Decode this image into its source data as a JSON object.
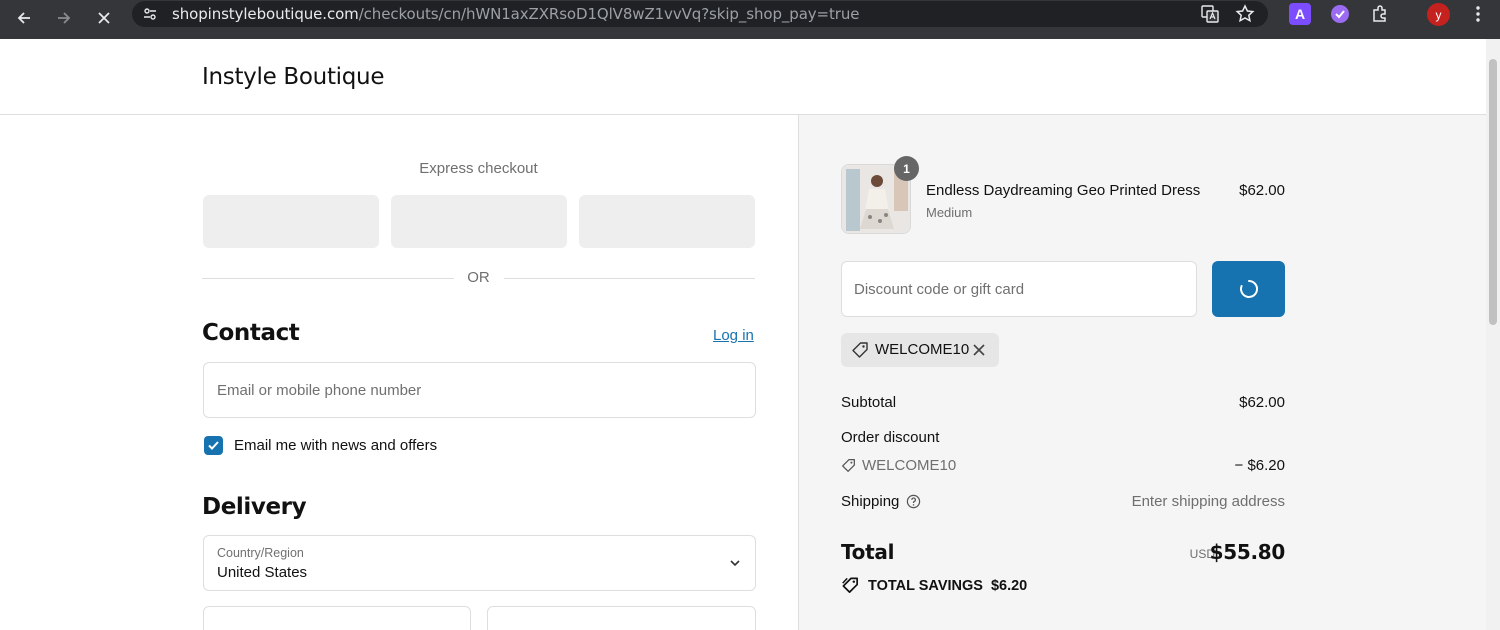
{
  "browser": {
    "url_host": "shopinstyleboutique.com",
    "url_path": "/checkouts/cn/hWN1axZXRsoD1QlV8wZ1vvVq?skip_shop_pay=true",
    "profile_initial": "Y",
    "extension_initial": "A",
    "icons": [
      "back-icon",
      "forward-icon",
      "stop-loading-icon",
      "site-settings-icon",
      "translate-icon",
      "star-icon",
      "extensions-icon",
      "menu-icon"
    ]
  },
  "header": {
    "shop_name": "Instyle Boutique"
  },
  "checkout": {
    "express_label": "Express checkout",
    "or_label": "OR",
    "contact": {
      "title": "Contact",
      "login_label": "Log in",
      "email_placeholder": "Email or mobile phone number",
      "newsletter_label": "Email me with news and offers",
      "newsletter_checked": true
    },
    "delivery": {
      "title": "Delivery",
      "country_label": "Country/Region",
      "country_value": "United States"
    }
  },
  "summary": {
    "product": {
      "name": "Endless Daydreaming Geo Printed Dress",
      "variant": "Medium",
      "price": "$62.00",
      "quantity": "1"
    },
    "discount_placeholder": "Discount code or gift card",
    "applied_code": "WELCOME10",
    "subtotal_label": "Subtotal",
    "subtotal_value": "$62.00",
    "order_discount_label": "Order discount",
    "discount_code": "WELCOME10",
    "discount_value": "− $6.20",
    "shipping_label": "Shipping",
    "shipping_value": "Enter shipping address",
    "total_label": "Total",
    "total_currency": "USD",
    "total_value": "$55.80",
    "savings_label": "TOTAL SAVINGS",
    "savings_value": "$6.20"
  },
  "colors": {
    "accent": "#1773b0",
    "summary_bg": "#f5f5f5",
    "chrome_bg": "#35363a"
  }
}
